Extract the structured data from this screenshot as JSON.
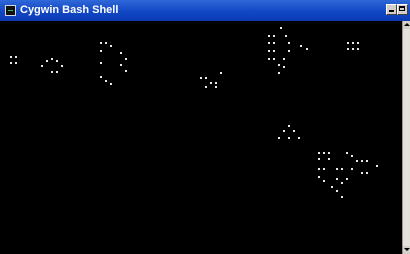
{
  "window": {
    "title": "Cygwin Bash Shell",
    "icon": "terminal-icon",
    "title_bar_color": "#1247c4",
    "background_color": "#000000",
    "cell_color": "#e8e8e8"
  },
  "caption_buttons": [
    {
      "name": "minimize-button",
      "icon": "minimize-icon"
    },
    {
      "name": "maximize-button",
      "icon": "maximize-icon"
    }
  ],
  "scrollbar": {
    "up_icon": "scroll-up-arrow-icon",
    "down_icon": "scroll-down-arrow-icon"
  }
}
